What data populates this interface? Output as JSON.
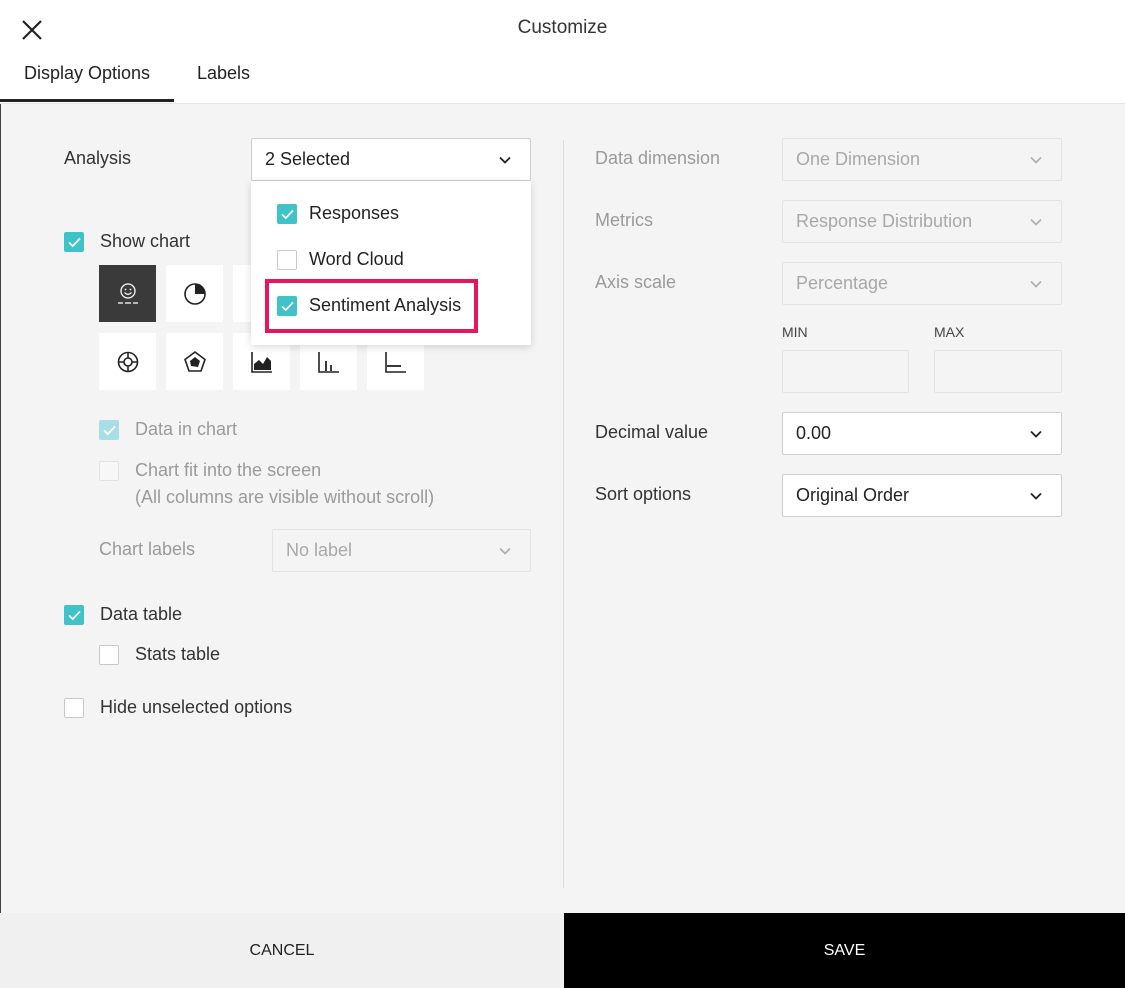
{
  "header": {
    "title": "Customize",
    "close_icon": "close-icon",
    "tabs": [
      {
        "label": "Display Options",
        "active": true
      },
      {
        "label": "Labels",
        "active": false
      }
    ]
  },
  "left": {
    "analysis": {
      "label": "Analysis",
      "value": "2 Selected",
      "options": [
        {
          "label": "Responses",
          "checked": true
        },
        {
          "label": "Word Cloud",
          "checked": false
        },
        {
          "label": "Sentiment Analysis",
          "checked": true
        }
      ]
    },
    "show_chart": {
      "label": "Show chart",
      "checked": true
    },
    "chart_types": [
      "sentiment-chart-icon",
      "pie-chart-icon",
      "donut-chart-icon",
      "polar-chart-icon",
      "radar-chart-icon",
      "area-chart-icon",
      "column-chart-icon",
      "bar-chart-icon"
    ],
    "data_in_chart": {
      "label": "Data in chart",
      "checked": true
    },
    "chart_fit": {
      "label": "Chart fit into the screen",
      "note": "(All columns are visible without scroll)",
      "checked": false
    },
    "chart_labels": {
      "label": "Chart labels",
      "value": "No label"
    },
    "data_table": {
      "label": "Data table",
      "checked": true
    },
    "stats_table": {
      "label": "Stats table",
      "checked": false
    },
    "hide_unselected": {
      "label": "Hide unselected options",
      "checked": false
    }
  },
  "right": {
    "data_dimension": {
      "label": "Data dimension",
      "value": "One Dimension"
    },
    "metrics": {
      "label": "Metrics",
      "value": "Response Distribution"
    },
    "axis_scale": {
      "label": "Axis scale",
      "value": "Percentage",
      "min_label": "MIN",
      "max_label": "MAX"
    },
    "decimal_value": {
      "label": "Decimal value",
      "value": "0.00"
    },
    "sort_options": {
      "label": "Sort options",
      "value": "Original Order"
    }
  },
  "footer": {
    "cancel": "CANCEL",
    "save": "SAVE"
  },
  "colors": {
    "accent": "#3fc3c8",
    "highlight": "#e8175d",
    "save_bg": "#000000"
  }
}
